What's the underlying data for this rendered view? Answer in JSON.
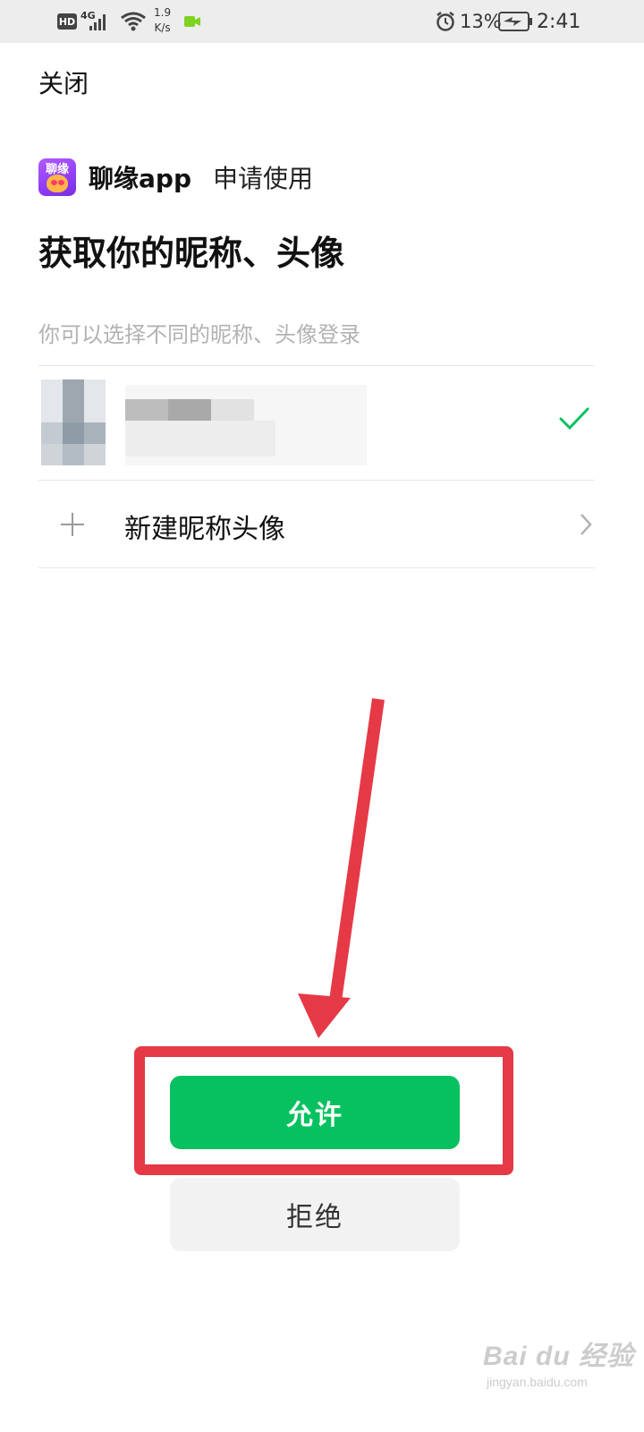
{
  "status_bar": {
    "hd_badge": "HD",
    "network_type": "4G",
    "speed_value": "1.9",
    "speed_unit": "K/s",
    "battery_percent": "13%",
    "time": "2:41",
    "icons": [
      "hd-icon",
      "signal-icon",
      "wifi-icon",
      "video-call-icon",
      "alarm-icon",
      "battery-charging-icon"
    ],
    "camera_color": "#7ed321"
  },
  "header": {
    "close_label": "关闭"
  },
  "app": {
    "logo_text": "聊缘",
    "name": "聊缘app",
    "request_text": "申请使用"
  },
  "permission": {
    "title": "获取你的昵称、头像",
    "hint": "你可以选择不同的昵称、头像登录"
  },
  "profile_option": {
    "selected": true,
    "check_color": "#07c160"
  },
  "new_profile": {
    "label": "新建昵称头像"
  },
  "actions": {
    "allow_label": "允许",
    "reject_label": "拒绝",
    "allow_color": "#07c160"
  },
  "annotation": {
    "color": "#e63946"
  },
  "watermark": {
    "main": "Bai du 经验",
    "sub": "jingyan.baidu.com"
  }
}
